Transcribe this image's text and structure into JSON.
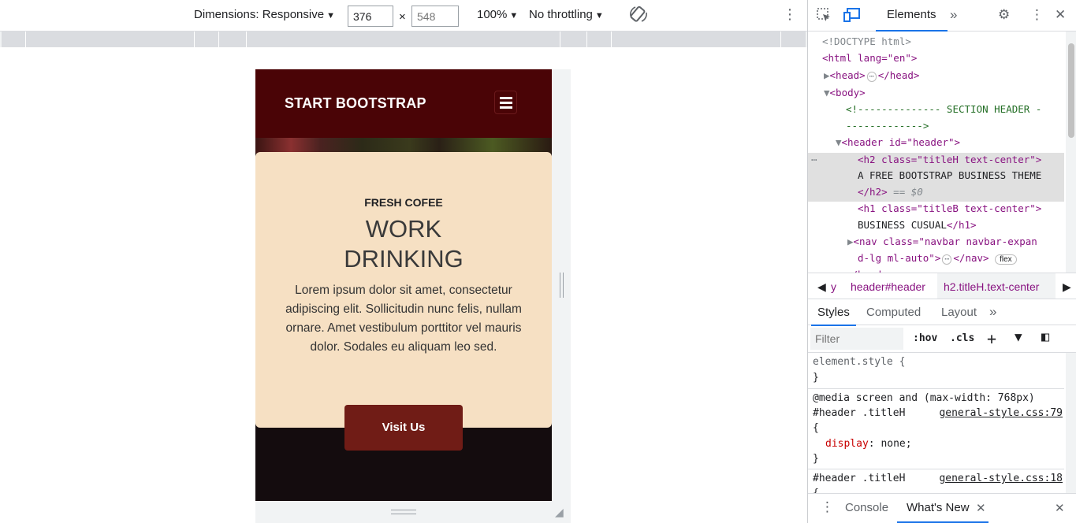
{
  "toolbar": {
    "dimensions_label": "Dimensions: Responsive",
    "width_value": "376",
    "height_value": "548",
    "times": "×",
    "zoom_label": "100%",
    "throttle_label": "No throttling"
  },
  "site": {
    "brand": "START BOOTSTRAP",
    "kicker": "FRESH COFEE",
    "heading_line1": "WORK",
    "heading_line2": "DRINKING",
    "paragraph": "Lorem ipsum dolor sit amet, consectetur adipiscing elit. Sollicitudin nunc felis, nullam ornare. Amet vestibulum porttitor vel mauris dolor. Sodales eu aliquam leo sed.",
    "button_label": "Visit Us",
    "colors": {
      "navbar": "#4a0406",
      "card": "#f6e0c3",
      "button": "#701c16"
    }
  },
  "devtools": {
    "tab_elements": "Elements",
    "dom": {
      "doctype": "<!DOCTYPE html>",
      "html_open": "<html lang=\"en\">",
      "head": "<head>",
      "head_close": "</head>",
      "body": "<body>",
      "comment1": "<!-------------- SECTION HEADER -",
      "comment2": "------------->",
      "header_open": "<header id=\"header\">",
      "h2_open": "<h2 class=\"titleH text-center\">",
      "h2_text": "A FREE BOOTSTRAP BUSINESS THEME",
      "h2_close": "</h2>",
      "selected_marker": "== $0",
      "h1_open": "<h1 class=\"titleB text-center\">",
      "h1_text": "BUSINESS CUSUAL",
      "h1_close": "</h1>",
      "nav_open": "<nav class=\"navbar navbar-expan",
      "nav_cont": "d-lg ml-auto\">",
      "nav_close": "</nav>",
      "flex_badge": "flex",
      "header_close": "</header>"
    },
    "breadcrumb": [
      "y",
      "header#header",
      "h2.titleH.text-center"
    ],
    "subtabs": [
      "Styles",
      "Computed",
      "Layout"
    ],
    "filter_placeholder": "Filter",
    "hov": ":hov",
    "cls": ".cls",
    "styles": {
      "element_style": "element.style {",
      "close_brace": "}",
      "media": "@media screen and (max-width: 768px)",
      "selector1": "#header .titleH",
      "source1": "general-style.css:79",
      "open_brace": "{",
      "prop_name": "display",
      "prop_value": "none;",
      "selector2": "#header .titleH",
      "source2": "general-style.css:18"
    },
    "drawer": [
      "Console",
      "What's New"
    ]
  }
}
